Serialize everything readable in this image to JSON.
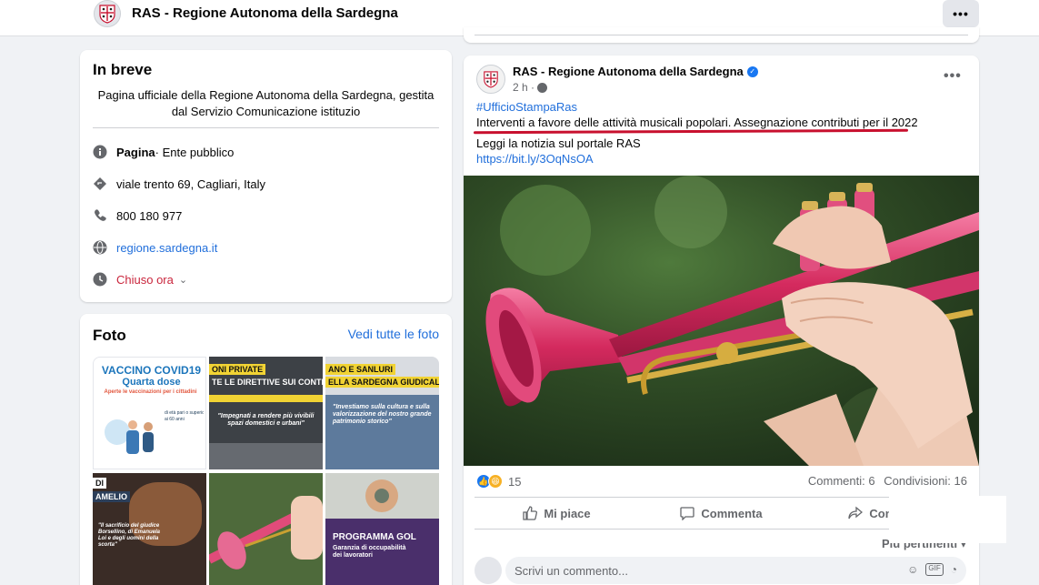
{
  "header": {
    "page_name": "RAS - Regione Autonoma della Sardegna",
    "more_label": "•••"
  },
  "intro": {
    "title": "In breve",
    "description": "Pagina ufficiale della Regione Autonoma della Sardegna, gestita dal Servizio Comunicazione istituzio",
    "category_bold": "Pagina",
    "category_rest": " · Ente pubblico",
    "address": "viale trento 69, Cagliari, Italy",
    "phone": "800 180 977",
    "website": "regione.sardegna.it",
    "hours": "Chiuso ora"
  },
  "photos": {
    "title": "Foto",
    "see_all": "Vedi tutte le foto",
    "items": [
      {
        "line1": "VACCINO COVID19",
        "line2": "Quarta dose",
        "line3": "Aperte le vaccinazioni per i cittadini"
      },
      {
        "line1": "ONI PRIVATE",
        "line2": "TE LE DIRETTIVE SUI CONTRIB",
        "line3": "\"Impegnati a rendere più vivibili spazi domestici e urbani\""
      },
      {
        "line1": "ANO E SANLURI",
        "line2": "ELLA SARDEGNA GIUDICALE",
        "line3": "\"Investiamo sulla cultura e sulla valorizzazione del nostro grande patrimonio storico\""
      },
      {
        "line1": "DI",
        "line2": "AMELIO",
        "line3": "\"Il sacrificio del giudice Borsellino, di Emanuela Loi e degli uomini della scorta\""
      },
      {
        "line1": "",
        "line2": "",
        "line3": ""
      },
      {
        "line1": "PROGRAMMA GOL",
        "line2": "Garanzia di occupabilità",
        "line3": "dei lavoratori"
      }
    ]
  },
  "post": {
    "author": "RAS - Regione Autonoma della Sardegna",
    "time": "2 h ·",
    "more_label": "•••",
    "hashtag": "#UfficioStampaRas",
    "headline": "Interventi a favore delle attività musicali popolari. Assegnazione contributi per il 2022",
    "read_more": "Leggi la notizia sul portale RAS",
    "link": "https://bit.ly/3OqNsOA",
    "reaction_count": "15",
    "comments": "Commenti: 6",
    "shares": "Condivisioni: 16",
    "actions": {
      "like": "Mi piace",
      "comment": "Commenta",
      "share": "Condividi"
    },
    "sort_label": "Più pertinenti ▾",
    "comment_placeholder": "Scrivi un commento..."
  },
  "colors": {
    "link": "#216fdb",
    "accent_red": "#c8102e",
    "brand_blue": "#1877f2"
  }
}
